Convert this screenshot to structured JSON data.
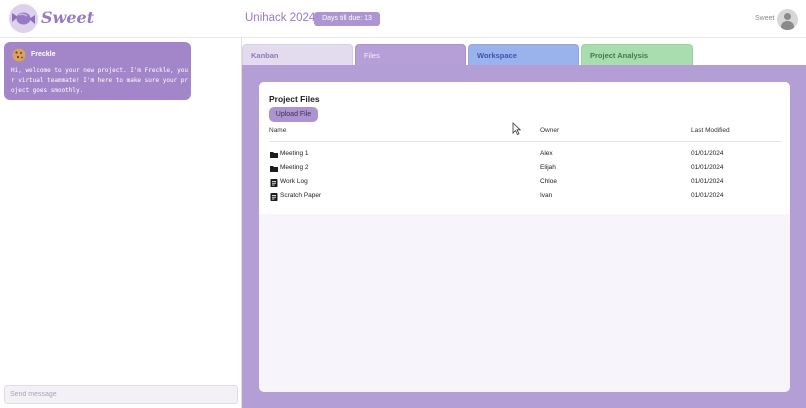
{
  "header": {
    "logo_text": "Sweet",
    "project_title": "Unihack 2024",
    "days_badge": "Days till due: 13",
    "user_name": "Sweet",
    "brand_color": "#9a79c4"
  },
  "chat": {
    "bot_name": "Freckle",
    "bot_avatar_icon": "cookie-icon",
    "message": "Hi, welcome to your new project. I'm Freckle, your virtual teammate! I'm here to make sure your project goes smoothly.",
    "input_placeholder": "Send message"
  },
  "tabs": [
    {
      "label": "Kanban",
      "color": "#e3dcee"
    },
    {
      "label": "Files",
      "color": "#b59fd6",
      "selected": true
    },
    {
      "label": "Workspace",
      "color": "#9bb3ec"
    },
    {
      "label": "Project Analysis",
      "color": "#a9ddb0"
    }
  ],
  "files": {
    "title": "Project Files",
    "upload_label": "Upload File",
    "columns": {
      "name": "Name",
      "owner": "Owner",
      "modified": "Last Modified"
    },
    "rows": [
      {
        "name": "Meeting 1",
        "owner": "Alex",
        "modified": "01/01/2024",
        "icon": "folder-icon"
      },
      {
        "name": "Meeting 2",
        "owner": "Elijah",
        "modified": "01/01/2024",
        "icon": "folder-icon"
      },
      {
        "name": "Work Log",
        "owner": "Chloe",
        "modified": "01/01/2024",
        "icon": "document-icon"
      },
      {
        "name": "Scratch Paper",
        "owner": "Ivan",
        "modified": "01/01/2024",
        "icon": "document-icon"
      }
    ]
  }
}
